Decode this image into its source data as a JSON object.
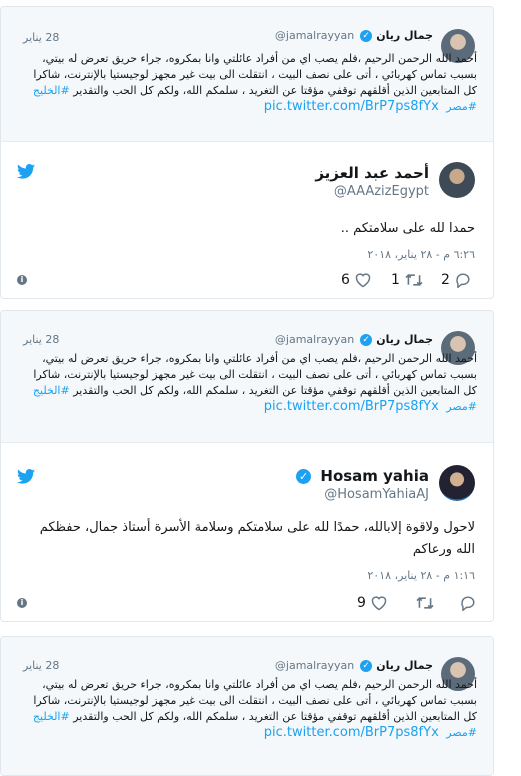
{
  "quote": {
    "name": "جمال ريان",
    "handle": "@jamalrayyan",
    "date": "28 يناير",
    "text": "أحمد الله الرحمن الرحيم ،فلم يصب اي من أفراد عائلتي وانا بمكروه، جراء حريق تعرض له بيتي، بسبب تماس كهربائي ، أتى على نصف البيت ، انتقلت الى بيت غير مجهز لوجيستيا بالإنترنت، شاكرا كل المتابعين الذين أقلقهم توقفي مؤقتا عن التغريد ، سلمكم الله، ولكم كل الحب والتقدير",
    "hashtags": "#الخليج #مصر",
    "link": "pic.twitter.com/BrP7ps8fYx"
  },
  "tweets": [
    {
      "name": "أحمد عبد العزيز",
      "handle": "@AAAzizEgypt",
      "text": "حمدا لله على سلامتكم ..",
      "time": "٦:٢٦ م - ٢٨ يناير، ٢٠١٨",
      "replies": "2",
      "retweets": "1",
      "likes": "6"
    },
    {
      "name": "Hosam yahia",
      "handle": "@HosamYahiaAJ",
      "text": "لاحول ولاقوة إلابالله، حمدًا لله على سلامتكم وسلامة الأسرة أستاذ جمال، حفظكم الله ورعاكم",
      "time": "١:١٦ م - ٢٨ يناير، ٢٠١٨",
      "replies": "",
      "retweets": "",
      "likes": "9"
    }
  ],
  "colors": {
    "brand": "#1da1f2",
    "muted": "#657786",
    "text": "#14171a"
  }
}
